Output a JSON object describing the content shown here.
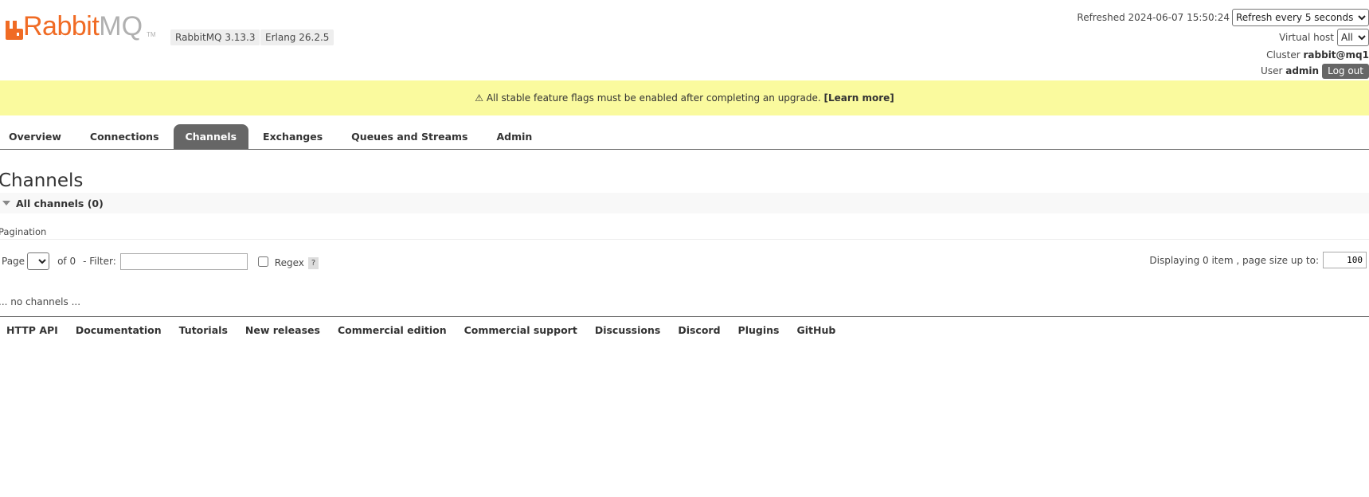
{
  "brand": {
    "name_part1": "Rabbit",
    "name_part2": "MQ",
    "trademark": "TM",
    "logo_color": "#f06b24",
    "versions": [
      "RabbitMQ 3.13.3",
      "Erlang 26.2.5"
    ]
  },
  "header": {
    "refreshed_label": "Refreshed",
    "refreshed_time": "2024-06-07 15:50:24",
    "refresh_select": "Refresh every 5 seconds",
    "vhost_label": "Virtual host",
    "vhost_select": "All",
    "cluster_label": "Cluster",
    "cluster_value": "rabbit@mq1",
    "user_label": "User",
    "user_value": "admin",
    "logout_label": "Log out"
  },
  "banner": {
    "icon": "⚠",
    "message": "All stable feature flags must be enabled after completing an upgrade.",
    "link": "[Learn more]",
    "background": "#fafa9e"
  },
  "tabs": [
    {
      "label": "Overview",
      "active": false
    },
    {
      "label": "Connections",
      "active": false
    },
    {
      "label": "Channels",
      "active": true
    },
    {
      "label": "Exchanges",
      "active": false
    },
    {
      "label": "Queues and Streams",
      "active": false
    },
    {
      "label": "Admin",
      "active": false
    }
  ],
  "main": {
    "title": "Channels",
    "section_title": "All channels (0)",
    "pagination_label": "Pagination",
    "page_label": "Page",
    "page_select": "",
    "of_text": "of 0",
    "filter_label": "- Filter:",
    "filter_value": "",
    "regex_label": "Regex",
    "regex_checked": false,
    "help_label": "?",
    "display_text": "Displaying 0 item , page size up to:",
    "page_size": "100",
    "empty_text": "... no channels ..."
  },
  "footer": {
    "links": [
      "HTTP API",
      "Documentation",
      "Tutorials",
      "New releases",
      "Commercial edition",
      "Commercial support",
      "Discussions",
      "Discord",
      "Plugins",
      "GitHub"
    ]
  }
}
